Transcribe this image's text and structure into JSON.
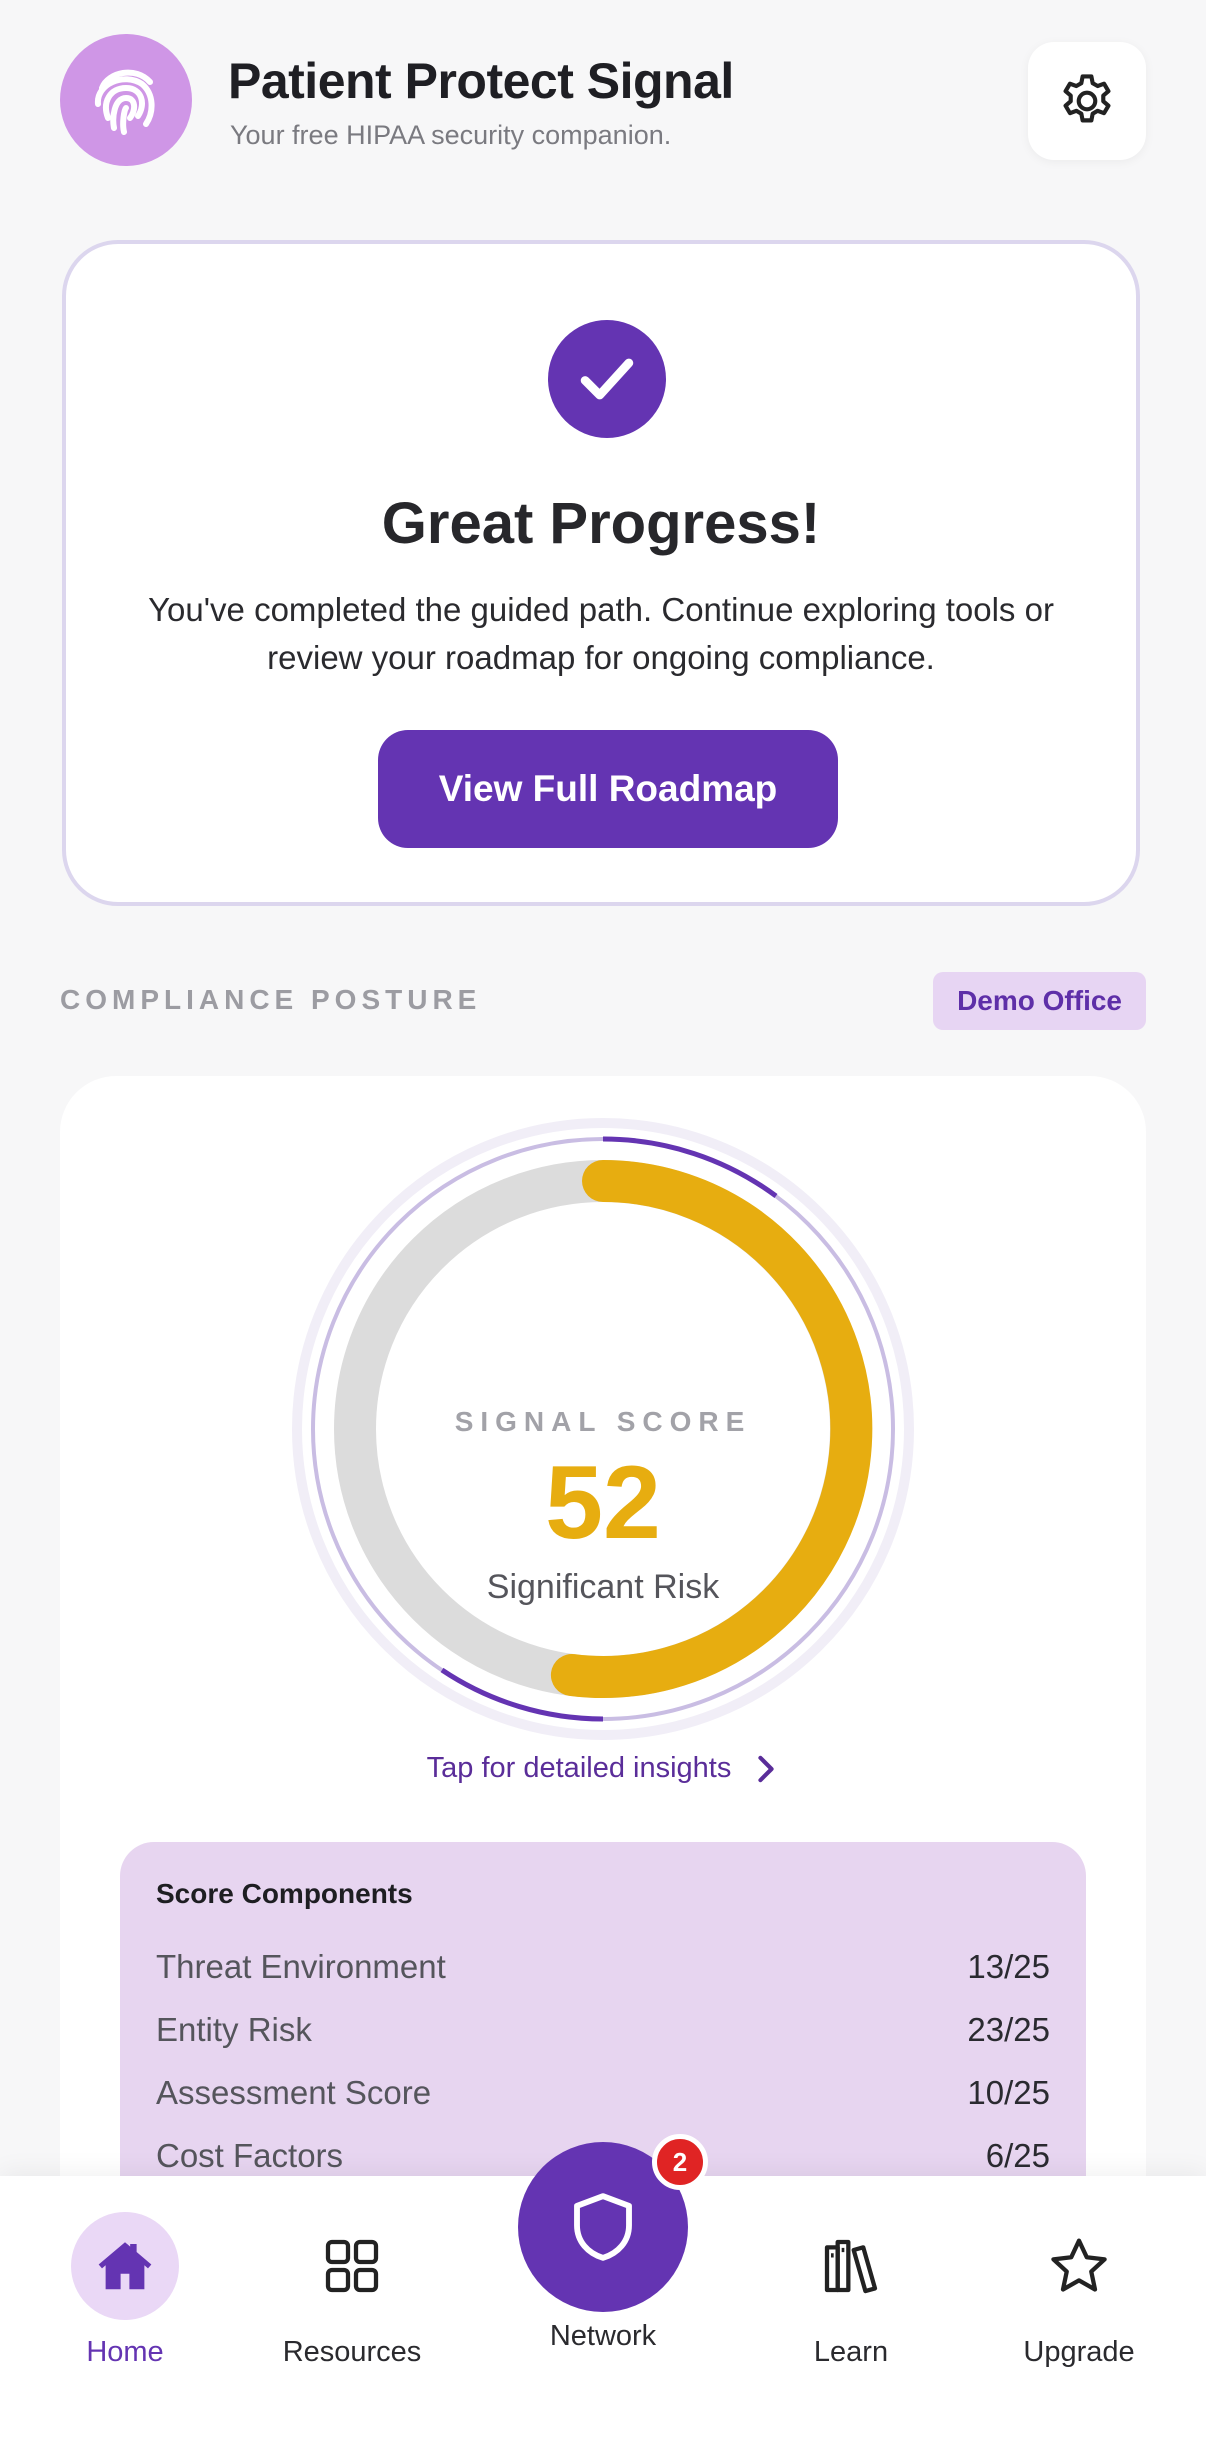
{
  "header": {
    "app_title": "Patient Protect Signal",
    "app_subtitle": "Your free HIPAA security companion.",
    "logo_icon": "fingerprint-icon",
    "settings_icon": "gear-icon"
  },
  "progress_card": {
    "icon": "check-icon",
    "title": "Great Progress!",
    "text": "You've completed the guided path. Continue exploring tools or review your roadmap for ongoing compliance.",
    "button_label": "View Full Roadmap"
  },
  "posture": {
    "section_label": "COMPLIANCE POSTURE",
    "office_badge": "Demo Office"
  },
  "score": {
    "label": "SIGNAL SCORE",
    "value": "52",
    "value_fraction": 0.52,
    "status": "Significant Risk",
    "insights_link": "Tap for detailed insights"
  },
  "components": {
    "title": "Score Components",
    "rows": [
      {
        "name": "Threat Environment",
        "value": "13/25"
      },
      {
        "name": "Entity Risk",
        "value": "23/25"
      },
      {
        "name": "Assessment Score",
        "value": "10/25"
      },
      {
        "name": "Cost Factors",
        "value": "6/25"
      }
    ]
  },
  "nav": {
    "items": [
      {
        "label": "Home",
        "icon": "home-icon",
        "active": true
      },
      {
        "label": "Resources",
        "icon": "grid-icon"
      },
      {
        "label": "Network",
        "icon": "shield-icon",
        "badge": "2"
      },
      {
        "label": "Learn",
        "icon": "books-icon"
      },
      {
        "label": "Upgrade",
        "icon": "star-icon"
      }
    ]
  },
  "colors": {
    "accent": "#6434b2",
    "score": "#e7ad10",
    "logo_bg": "#cf96e6",
    "badge": "#e02424"
  }
}
